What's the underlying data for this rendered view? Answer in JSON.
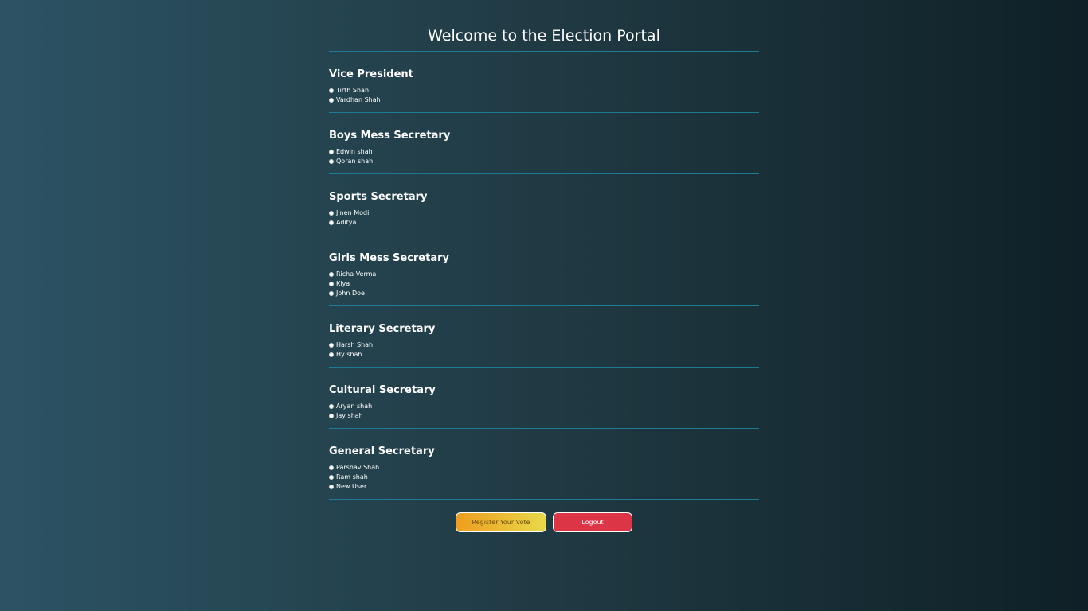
{
  "page": {
    "title": "Welcome to the Election Portal"
  },
  "sections": [
    {
      "title": "Vice President",
      "candidates": [
        "Tirth Shah",
        "Vardhan Shah"
      ]
    },
    {
      "title": "Boys Mess Secretary",
      "candidates": [
        "Edwin shah",
        "Qoran shah"
      ]
    },
    {
      "title": "Sports Secretary",
      "candidates": [
        "Jinen Modi",
        "Aditya"
      ]
    },
    {
      "title": "Girls Mess Secretary",
      "candidates": [
        "Richa Verma",
        "Kiya",
        "John Doe"
      ]
    },
    {
      "title": "Literary Secretary",
      "candidates": [
        "Harsh Shah",
        "Hy shah"
      ]
    },
    {
      "title": "Cultural Secretary",
      "candidates": [
        "Aryan shah",
        "Jay shah"
      ]
    },
    {
      "title": "General Secretary",
      "candidates": [
        "Parshav Shah",
        "Ram shah",
        "New User"
      ]
    }
  ],
  "actions": {
    "register_label": "Register Your Vote",
    "logout_label": "Logout"
  },
  "colors": {
    "divider": "#1f7a95",
    "register_gradient_start": "#ef9d1f",
    "register_gradient_end": "#e8d94a",
    "logout": "#dc3545"
  }
}
